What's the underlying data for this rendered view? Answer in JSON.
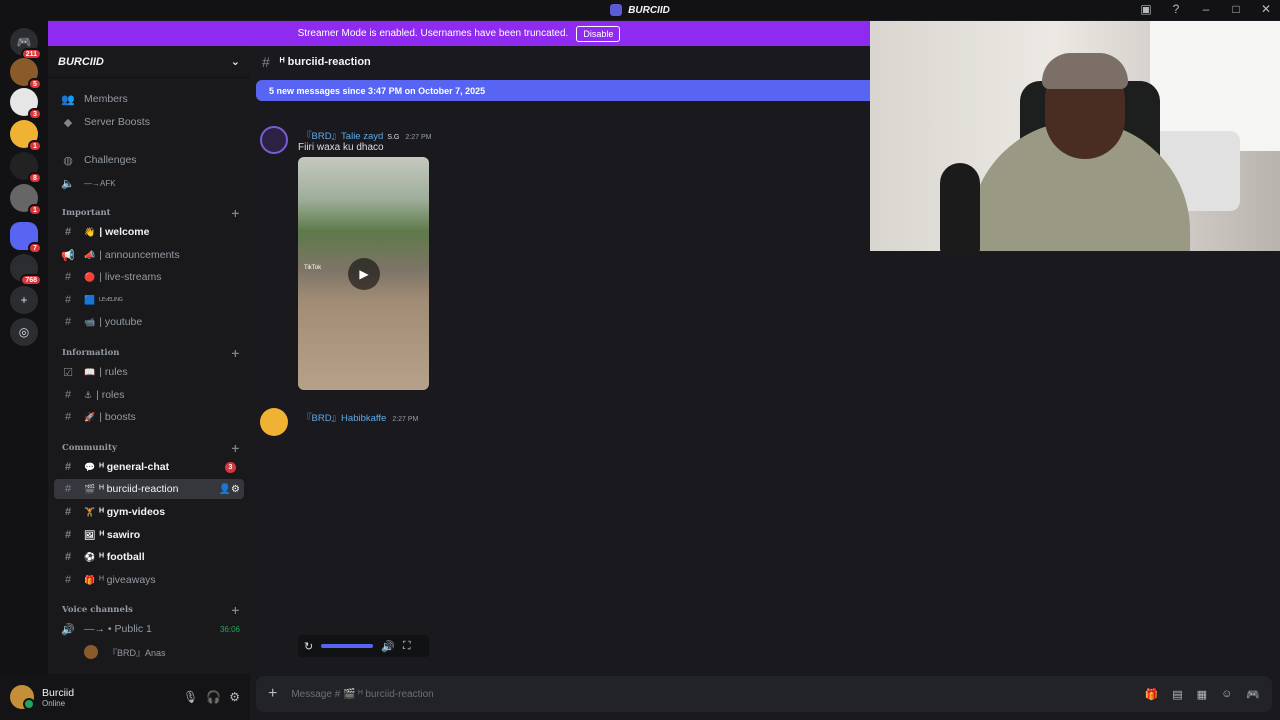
{
  "app": {
    "title": "BURCIID"
  },
  "banner": {
    "text": "Streamer Mode is enabled. Usernames have been truncated.",
    "button": "Disable"
  },
  "servers": {
    "home_badge": "211",
    "items": [
      {
        "badge": "5"
      },
      {
        "badge": "3"
      },
      {
        "badge": "1"
      },
      {
        "badge": "8"
      },
      {
        "badge": "1"
      },
      {
        "badge": "7"
      },
      {
        "badge": "768"
      }
    ]
  },
  "sidebar": {
    "server_name": "BURCIID",
    "top_items": [
      {
        "label": "Members"
      },
      {
        "label": "Server Boosts"
      },
      {
        "label": "Challenges"
      },
      {
        "label": "—→AFK"
      }
    ],
    "categories": {
      "important": "Important",
      "information": "Information",
      "community": "Community",
      "voice": "Voice channels"
    },
    "channels_important": [
      {
        "label": "| welcome",
        "emoji": "👋"
      },
      {
        "label": "| announcements",
        "emoji": "📣"
      },
      {
        "label": "| live-streams",
        "emoji": "🔴"
      },
      {
        "label": "ᴸᴱᵛᴱᴸᴵᴺᴳ",
        "emoji": "🟦"
      },
      {
        "label": "| youtube",
        "emoji": "📹"
      }
    ],
    "channels_information": [
      {
        "label": "| rules",
        "emoji": "📖"
      },
      {
        "label": "| roles",
        "emoji": "⚓"
      },
      {
        "label": "| boosts",
        "emoji": "🚀"
      }
    ],
    "channels_community": [
      {
        "label": "ᴴ general-chat",
        "emoji": "💬",
        "badge": "3"
      },
      {
        "label": "ᴴ burciid-reaction",
        "emoji": "🎬"
      },
      {
        "label": "ᴴ gym-videos",
        "emoji": "🏋"
      },
      {
        "label": "ᴴ sawiro",
        "emoji": "🖼"
      },
      {
        "label": "ᴴ football",
        "emoji": "⚽"
      },
      {
        "label": "ᴴ giveaways",
        "emoji": "🎁"
      }
    ],
    "voice": {
      "channel": "—→ • Public 1",
      "time": "36:06",
      "member": "『BRD』Anas"
    }
  },
  "user": {
    "name": "Burciid",
    "status": "Online"
  },
  "channel": {
    "name": "ᴴ burciid-reaction",
    "new_messages": "5 new messages since 3:47 PM on October 7, 2025"
  },
  "messages": [
    {
      "author": "『BRD』Talie zayd",
      "tag": "S.G",
      "time": "2:27 PM",
      "text": "Fiiri waxa ku dhaco"
    },
    {
      "author": "『BRD』Habibkaffe",
      "time": "2:27 PM"
    }
  ],
  "video": {
    "watermark": "TikTok"
  },
  "composer": {
    "placeholder": "Message # 🎬 ᴴ burciid-reaction"
  },
  "colors": {
    "accent": "#5865f2",
    "banner": "#8f2bf0",
    "danger": "#da373c",
    "online": "#23a55a",
    "link": "#5ea9e6"
  }
}
